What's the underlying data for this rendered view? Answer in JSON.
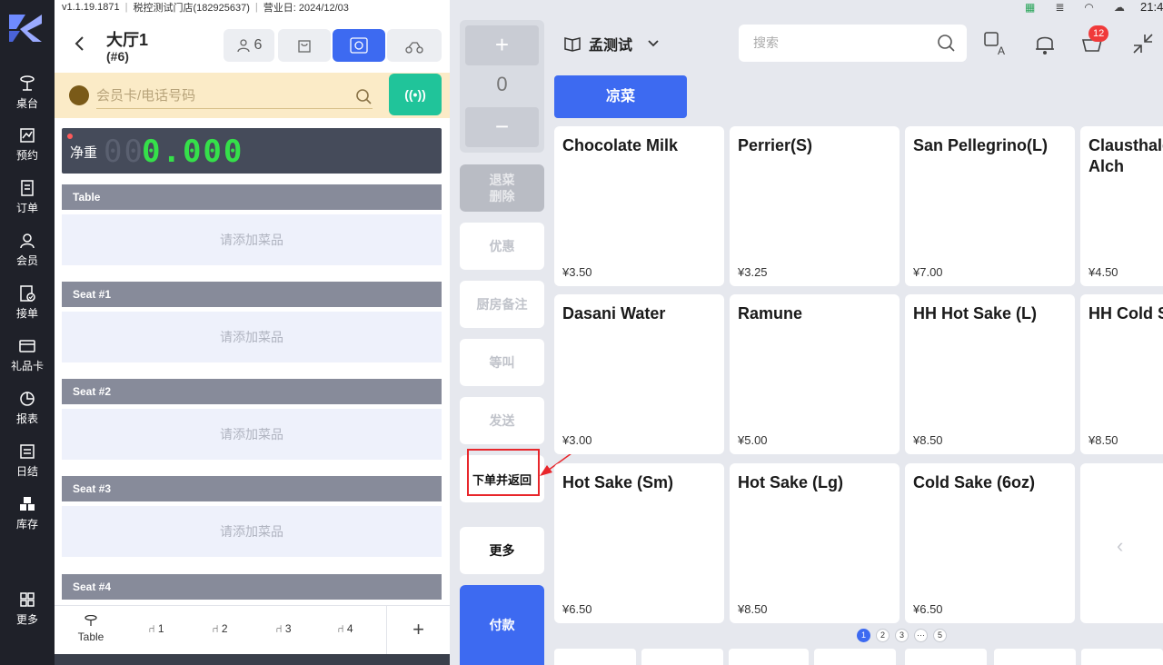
{
  "status_bar": {
    "version": "v1.1.19.1871",
    "store": "税控测试门店(182925637)",
    "business_day": "营业日: 2024/12/03",
    "time": "21:4"
  },
  "nav": {
    "items": [
      {
        "label": "桌台",
        "icon": "table-icon"
      },
      {
        "label": "预约",
        "icon": "reservation-icon"
      },
      {
        "label": "订单",
        "icon": "order-icon"
      },
      {
        "label": "会员",
        "icon": "member-icon"
      },
      {
        "label": "接单",
        "icon": "accept-order-icon"
      },
      {
        "label": "礼品卡",
        "icon": "gift-card-icon"
      },
      {
        "label": "报表",
        "icon": "report-icon"
      },
      {
        "label": "日结",
        "icon": "daily-close-icon"
      },
      {
        "label": "库存",
        "icon": "inventory-icon"
      }
    ],
    "more": "更多"
  },
  "order": {
    "title": "大厅1",
    "subtitle": "(#6)",
    "guests": "6",
    "member_placeholder": "会员卡/电话号码",
    "scale": {
      "label": "净重",
      "ghost": "00",
      "value": "0.000"
    },
    "sections": [
      {
        "header": "Table",
        "empty": "请添加菜品"
      },
      {
        "header": "Seat #1",
        "empty": "请添加菜品"
      },
      {
        "header": "Seat #2",
        "empty": "请添加菜品"
      },
      {
        "header": "Seat #3",
        "empty": "请添加菜品"
      },
      {
        "header": "Seat #4",
        "empty": ""
      }
    ],
    "seat_tabs": [
      {
        "label": "Table"
      },
      {
        "label": "1"
      },
      {
        "label": "2"
      },
      {
        "label": "3"
      },
      {
        "label": "4"
      }
    ],
    "add_seat": "+"
  },
  "actions": {
    "plus": "+",
    "qty": "0",
    "minus": "−",
    "void": "退菜\n删除",
    "discount": "优惠",
    "kitchen_note": "厨房备注",
    "hold": "等叫",
    "send": "发送",
    "order_return": "下单并返回",
    "more": "更多",
    "pay": "付款"
  },
  "catalog": {
    "store_name": "孟测试",
    "search_placeholder": "搜索",
    "notification_count": "12",
    "category": "凉菜",
    "products": [
      {
        "name": "Chocolate Milk",
        "price": "¥3.50"
      },
      {
        "name": "Perrier(S)",
        "price": "¥3.25"
      },
      {
        "name": "San Pellegrino(L)",
        "price": "¥7.00"
      },
      {
        "name": "Clausthaler Non-Alch",
        "price": "¥4.50"
      },
      {
        "name": "Dasani Water",
        "price": "¥3.00"
      },
      {
        "name": "Ramune",
        "price": "¥5.00"
      },
      {
        "name": "HH Hot Sake (L)",
        "price": "¥8.50"
      },
      {
        "name": "HH Cold Sake",
        "price": "¥8.50"
      },
      {
        "name": "Hot Sake (Sm)",
        "price": "¥6.50"
      },
      {
        "name": "Hot Sake (Lg)",
        "price": "¥8.50"
      },
      {
        "name": "Cold Sake (6oz)",
        "price": "¥6.50"
      }
    ],
    "pager": [
      "1",
      "2",
      "3",
      "···",
      "5"
    ],
    "current_page": "1"
  },
  "colors": {
    "accent": "#3d6af1",
    "nfc": "#20c49a",
    "highlight": "#e8262b"
  }
}
